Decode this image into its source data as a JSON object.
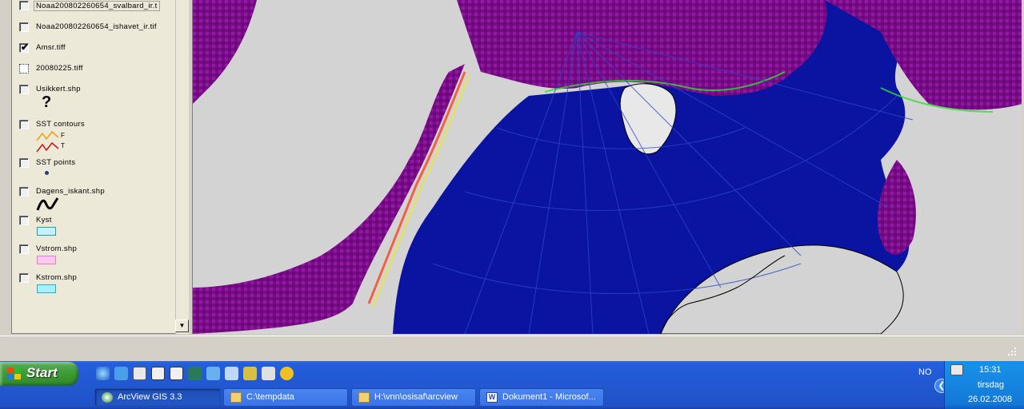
{
  "legend": {
    "items": [
      {
        "label": "Noaa200802260654_svalbard_ir.t",
        "checked": false
      },
      {
        "label": "Noaa200802260654_ishavet_ir.tif",
        "checked": false
      },
      {
        "label": "Amsr.tiff",
        "checked": true
      },
      {
        "label": "20080225.tiff",
        "checked": false
      },
      {
        "label": "Usikkert.shp",
        "checked": false,
        "symbol": "?"
      },
      {
        "label": "SST contours",
        "checked": false,
        "sub": [
          "F",
          "T"
        ]
      },
      {
        "label": "SST points",
        "checked": false
      },
      {
        "label": "Dagens_iskant.shp",
        "checked": false
      },
      {
        "label": "Kyst",
        "checked": false
      },
      {
        "label": "Vstrom.shp",
        "checked": false
      },
      {
        "label": "Kstrom.shp",
        "checked": false
      }
    ]
  },
  "taskbar": {
    "start_label": "Start",
    "tasks": [
      {
        "label": "ArcView GIS 3.3",
        "icon": "arcview-icon"
      },
      {
        "label": "C:\\tempdata",
        "icon": "folder-icon"
      },
      {
        "label": "H:\\vnn\\osisaf\\arcview",
        "icon": "folder-icon"
      },
      {
        "label": "Dokument1 - Microsof...",
        "icon": "word-icon"
      }
    ],
    "language": "NO",
    "clock": {
      "time": "15:31",
      "day": "tirsdag",
      "date": "26.02.2008"
    }
  },
  "colors": {
    "ocean": "#0a14a0",
    "land": "#d3d3d3",
    "ice": "#7a0a8a",
    "taskbar": "#245edb",
    "start": "#3c9a34"
  }
}
